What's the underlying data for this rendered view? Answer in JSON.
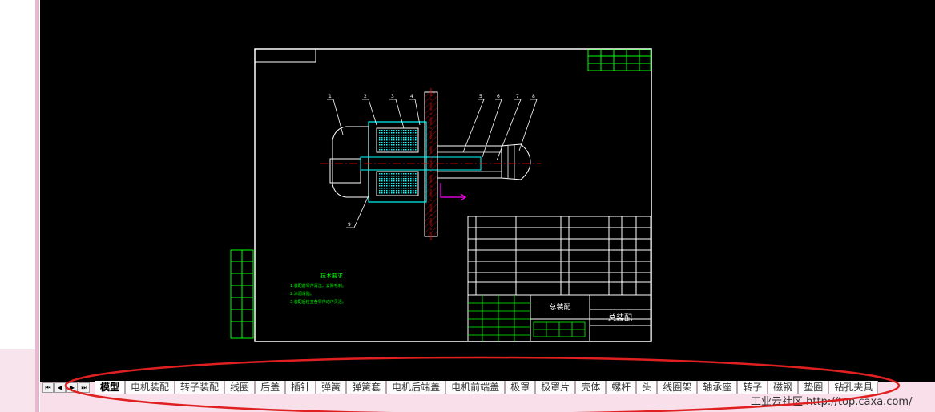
{
  "navigation": {
    "first_label": "⏮",
    "prev_label": "◀",
    "next_label": "▶",
    "last_label": "⏭"
  },
  "tabs": [
    {
      "label": "模型",
      "active": true
    },
    {
      "label": "电机装配"
    },
    {
      "label": "转子装配"
    },
    {
      "label": "线圈"
    },
    {
      "label": "后盖"
    },
    {
      "label": "插针"
    },
    {
      "label": "弹簧"
    },
    {
      "label": "弹簧套"
    },
    {
      "label": "电机后端盖"
    },
    {
      "label": "电机前端盖"
    },
    {
      "label": "极罩"
    },
    {
      "label": "极罩片"
    },
    {
      "label": "壳体"
    },
    {
      "label": "螺杆"
    },
    {
      "label": "头"
    },
    {
      "label": "线圈架"
    },
    {
      "label": "轴承座"
    },
    {
      "label": "转子"
    },
    {
      "label": "磁钢"
    },
    {
      "label": "垫圈"
    },
    {
      "label": "钻孔夹具"
    }
  ],
  "watermark": "工业云社区 http://top.caxa.com/",
  "drawing": {
    "tech_requirements_title": "技术要求",
    "note_lines": [
      "1.装配前零件清洗，去除毛刺。",
      "2.涂润滑脂。",
      "3.装配后检查各零件动作灵活。"
    ],
    "title_block_name": "总装配",
    "balloon_labels": [
      "1",
      "2",
      "3",
      "4",
      "5",
      "6",
      "7",
      "8",
      "9"
    ]
  },
  "colors": {
    "canvas_bg": "#000000",
    "frame": "#ffffff",
    "cad_green": "#00ff00",
    "cad_cyan": "#00ffff",
    "cad_magenta": "#ff00ff",
    "cad_red": "#ff0000",
    "annotation_red": "#e02020",
    "tab_bar_bg": "#f8dfea"
  }
}
